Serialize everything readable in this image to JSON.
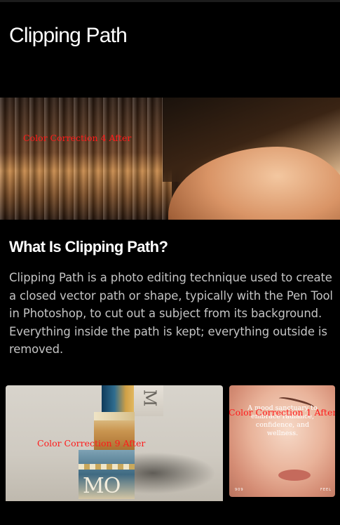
{
  "page": {
    "title": "Clipping Path"
  },
  "hero": {
    "alt": "Color Correction 4 After"
  },
  "section": {
    "heading": "What Is Clipping Path?",
    "body": "Clipping Path is a photo editing technique used to create a closed vector path or shape, typically with the Pen Tool in Photoshop, to cut out a subject from its background. Everything inside the path is kept; everything outside is removed."
  },
  "gallery": {
    "product": {
      "alt": "Color Correction 9 After",
      "box_top_letter": "M",
      "box_base_letters": "MO"
    },
    "face": {
      "alt": "Color Correction 1 After",
      "quote": "A mood sanctuary to embrace radiance, confidence, and wellness.",
      "footer_left": "909",
      "footer_right": "FEEL"
    }
  }
}
